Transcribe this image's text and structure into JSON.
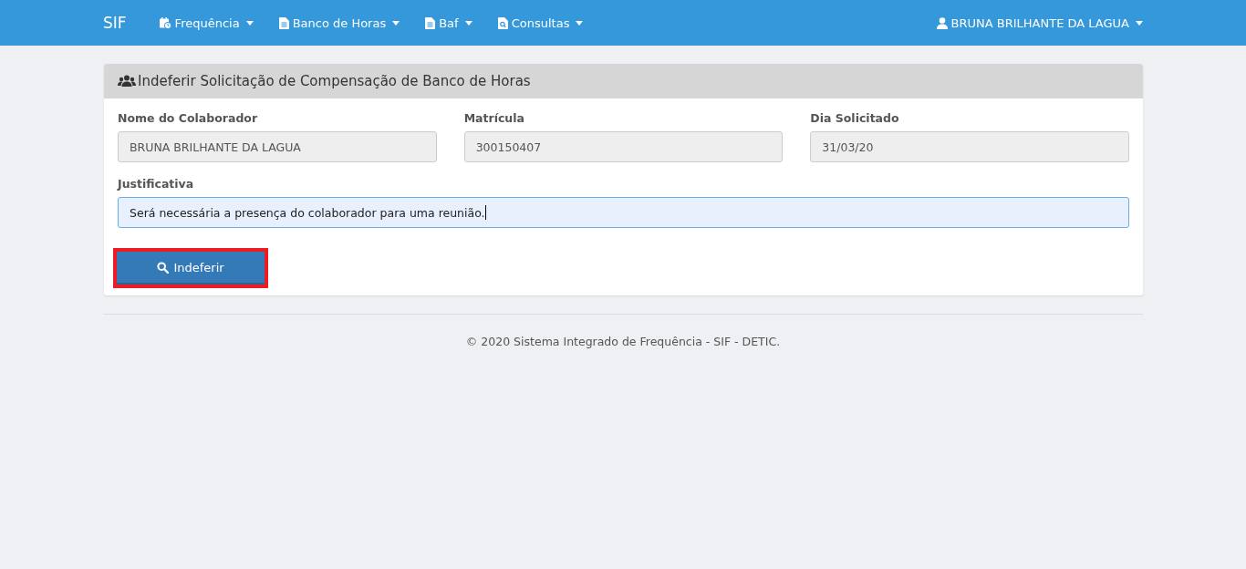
{
  "navbar": {
    "brand": "SIF",
    "menus": [
      {
        "label": "Frequência"
      },
      {
        "label": "Banco de Horas"
      },
      {
        "label": "Baf"
      },
      {
        "label": "Consultas"
      }
    ],
    "user": "BRUNA BRILHANTE DA LAGUA"
  },
  "panel": {
    "title": "Indeferir Solicitação de Compensação de Banco de Horas",
    "fields": [
      {
        "label": "Nome do Colaborador",
        "value": "BRUNA BRILHANTE DA LAGUA",
        "disabled": true
      },
      {
        "label": "Matrícula",
        "value": "300150407",
        "disabled": true
      },
      {
        "label": "Dia Solicitado",
        "value": "31/03/20",
        "disabled": true
      }
    ],
    "justification": {
      "label": "Justificativa",
      "value": "Será necessária a presença do colaborador para uma reunião.",
      "focused": true
    },
    "button": {
      "label": "Indeferir",
      "highlighted": true
    }
  },
  "footer": "© 2020 Sistema Integrado de Frequência - SIF - DETIC."
}
